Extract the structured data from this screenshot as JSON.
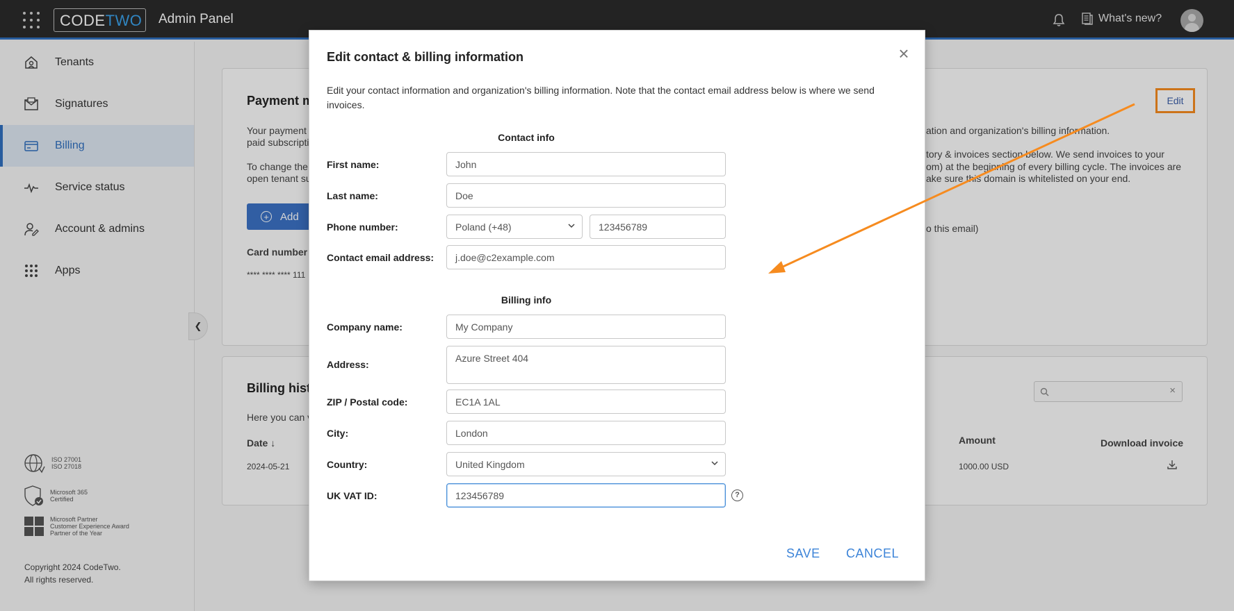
{
  "topbar": {
    "logo_code": "CODE",
    "logo_two": "TWO",
    "app_title": "Admin Panel",
    "whats_new": "What's new?"
  },
  "sidebar": {
    "items": [
      {
        "label": "Tenants",
        "icon": "home-icon"
      },
      {
        "label": "Signatures",
        "icon": "signature-icon"
      },
      {
        "label": "Billing",
        "icon": "card-icon",
        "active": true
      },
      {
        "label": "Service status",
        "icon": "pulse-icon"
      },
      {
        "label": "Account & admins",
        "icon": "user-edit-icon"
      },
      {
        "label": "Apps",
        "icon": "apps-icon"
      }
    ],
    "certs": [
      {
        "line1": "ISO 27001",
        "line2": "ISO 27018",
        "line3": ""
      },
      {
        "line1": "Microsoft 365",
        "line2": "Certified",
        "line3": ""
      },
      {
        "line1": "Microsoft Partner",
        "line2": "Customer Experience Award",
        "line3": "Partner of the Year"
      }
    ],
    "copyright_line1": "Copyright 2024 CodeTwo.",
    "copyright_line2": "All rights reserved."
  },
  "background": {
    "payment_heading": "Payment m",
    "payment_line1": "Your payment",
    "payment_line2": "paid subscripti",
    "payment_line3": "To change the",
    "payment_line4": "open tenant su",
    "add_label": "Add",
    "card_number_label": "Card number",
    "card_number_value": "**** **** **** 111",
    "right_line1": "ation and organization's billing information.",
    "right_line2": "tory & invoices section below. We send invoices to your",
    "right_line3": "om) at the beginning of every billing cycle. The invoices are",
    "right_line4": "ake sure this domain is whitelisted on your end.",
    "right_line5": "o this email)",
    "edit_label": "Edit",
    "billing_heading": "Billing hist",
    "billing_line": "Here you can v",
    "date_header": "Date ↓",
    "amount_header": "Amount",
    "download_header": "Download invoice",
    "row_date": "2024-05-21",
    "row_amount": "1000.00 USD"
  },
  "modal": {
    "title": "Edit contact & billing information",
    "description": "Edit your contact information and organization's billing information. Note that the contact email address below is where we send invoices.",
    "contact_section": "Contact info",
    "billing_section": "Billing info",
    "first_name_label": "First name:",
    "first_name_value": "John",
    "last_name_label": "Last name:",
    "last_name_value": "Doe",
    "phone_label": "Phone number:",
    "phone_country": "Poland (+48)",
    "phone_value": "123456789",
    "email_label": "Contact email address:",
    "email_value": "j.doe@c2example.com",
    "company_label": "Company name:",
    "company_value": "My Company",
    "address_label": "Address:",
    "address_value": "Azure Street 404",
    "zip_label": "ZIP / Postal code:",
    "zip_value": "EC1A 1AL",
    "city_label": "City:",
    "city_value": "London",
    "country_label": "Country:",
    "country_value": "United Kingdom",
    "vat_label": "UK VAT ID:",
    "vat_value": "123456789",
    "help_glyph": "?",
    "save_label": "SAVE",
    "cancel_label": "CANCEL"
  },
  "colors": {
    "accent": "#2f6fbf",
    "annotation": "#f68b1f",
    "link": "#3d84d8"
  }
}
